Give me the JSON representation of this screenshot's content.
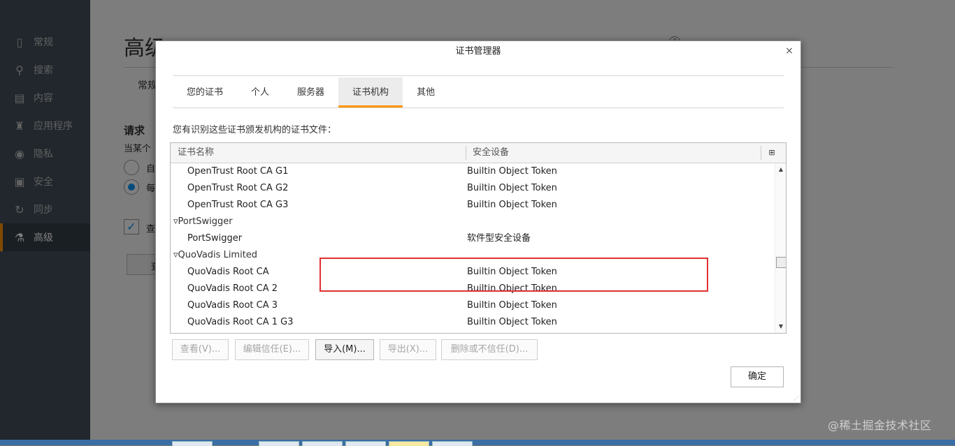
{
  "sidebar": {
    "items": [
      {
        "label": "常规",
        "icon": "general-icon",
        "glyph": "▯"
      },
      {
        "label": "搜索",
        "icon": "search-icon",
        "glyph": "⚲"
      },
      {
        "label": "内容",
        "icon": "content-icon",
        "glyph": "▤"
      },
      {
        "label": "应用程序",
        "icon": "applications-icon",
        "glyph": "♜"
      },
      {
        "label": "隐私",
        "icon": "privacy-mask-icon",
        "glyph": "◉"
      },
      {
        "label": "安全",
        "icon": "security-lock-icon",
        "glyph": "▣"
      },
      {
        "label": "同步",
        "icon": "sync-icon",
        "glyph": "↻"
      },
      {
        "label": "高级",
        "icon": "advanced-icon",
        "glyph": "⚗",
        "active": true
      }
    ]
  },
  "page": {
    "title": "高级",
    "tab_partial": "常规",
    "section": "请求",
    "section_text": "当某个",
    "radio1": "自",
    "radio2": "每",
    "checkbox_label": "查",
    "button_partial": "查",
    "help": "?"
  },
  "dialog": {
    "title": "证书管理器",
    "close": "×",
    "tabs": [
      {
        "label": "您的证书"
      },
      {
        "label": "个人"
      },
      {
        "label": "服务器"
      },
      {
        "label": "证书机构",
        "active": true
      },
      {
        "label": "其他"
      }
    ],
    "description": "您有识别这些证书颁发机构的证书文件：",
    "columns": {
      "name": "证书名称",
      "device": "安全设备",
      "picker": "⊞"
    },
    "rows": [
      {
        "type": "cert",
        "name": "OpenTrust Root CA G1",
        "device": "Builtin Object Token"
      },
      {
        "type": "cert",
        "name": "OpenTrust Root CA G2",
        "device": "Builtin Object Token"
      },
      {
        "type": "cert",
        "name": "OpenTrust Root CA G3",
        "device": "Builtin Object Token"
      },
      {
        "type": "group",
        "name": "▿PortSwigger",
        "device": ""
      },
      {
        "type": "cert",
        "name": "PortSwigger",
        "device": "软件型安全设备"
      },
      {
        "type": "group",
        "name": "▿QuoVadis Limited",
        "device": ""
      },
      {
        "type": "cert",
        "name": "QuoVadis Root CA",
        "device": "Builtin Object Token"
      },
      {
        "type": "cert",
        "name": "QuoVadis Root CA 2",
        "device": "Builtin Object Token"
      },
      {
        "type": "cert",
        "name": "QuoVadis Root CA 3",
        "device": "Builtin Object Token"
      },
      {
        "type": "cert",
        "name": "QuoVadis Root CA 1 G3",
        "device": "Builtin Object Token"
      }
    ],
    "scroll": {
      "up": "▲",
      "down": "▼"
    },
    "buttons": {
      "view": "查看(V)...",
      "edit_trust": "编辑信任(E)...",
      "import": "导入(M)...",
      "export": "导出(X)...",
      "delete": "删除或不信任(D)...",
      "ok": "确定"
    },
    "highlight_color": "#e03030",
    "accent_color": "#ff9500"
  },
  "watermark": "@稀土掘金技术社区"
}
